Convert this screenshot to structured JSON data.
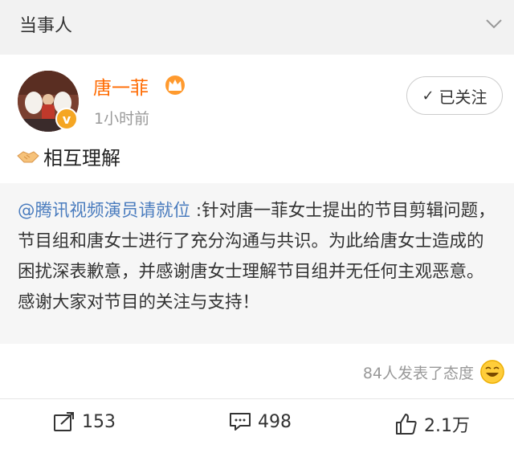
{
  "header": {
    "title": "当事人"
  },
  "user": {
    "name": "唐一菲",
    "time": "1小时前",
    "verified_mark": "v"
  },
  "follow_button": {
    "check": "✓",
    "label": "已关注"
  },
  "post": {
    "text": "相互理解"
  },
  "repost": {
    "mention": "@腾讯视频演员请就位",
    "text": ":针对唐一菲女士提出的节目剪辑问题，节目组和唐女士进行了充分沟通与共识。为此给唐女士造成的困扰深表歉意，并感谢唐女士理解节目组并无任何主观恶意。感谢大家对节目的关注与支持！"
  },
  "reactions": {
    "text": "84人发表了态度"
  },
  "actions": {
    "repost_count": "153",
    "comment_count": "498",
    "like_count": "2.1万"
  },
  "colors": {
    "username": "#ff6a00",
    "mention": "#4a7cbe",
    "badge": "#f5a623"
  }
}
